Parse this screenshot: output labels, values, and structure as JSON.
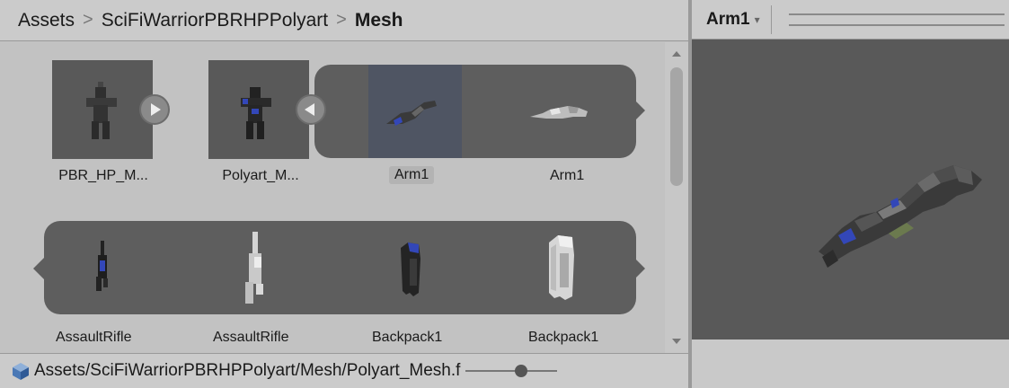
{
  "breadcrumb": {
    "items": [
      "Assets",
      "SciFiWarriorPBRHPPolyart"
    ],
    "current": "Mesh"
  },
  "assets": {
    "row1": [
      {
        "label": "PBR_HP_M...",
        "icon": "character-model-icon"
      },
      {
        "label": "Polyart_M...",
        "icon": "character-model-icon"
      },
      {
        "label": "Arm1",
        "icon": "arm-mesh-icon",
        "selected": true
      },
      {
        "label": "Arm1",
        "icon": "arm-mesh-icon"
      }
    ],
    "row2": [
      {
        "label": "AssaultRifle",
        "icon": "rifle-mesh-icon"
      },
      {
        "label": "AssaultRifle",
        "icon": "rifle-mesh-icon"
      },
      {
        "label": "Backpack1",
        "icon": "backpack-mesh-icon"
      },
      {
        "label": "Backpack1",
        "icon": "backpack-mesh-icon"
      }
    ]
  },
  "status": {
    "path": "Assets/SciFiWarriorPBRHPPolyart/Mesh/Polyart_Mesh.f",
    "zoom_fraction": 0.62
  },
  "preview": {
    "dropdown_label": "Arm1",
    "caret": "▾"
  },
  "colors": {
    "accent_blue": "#3347b8",
    "thumb_bg": "#595959",
    "panel_bg": "#c2c2c2"
  }
}
